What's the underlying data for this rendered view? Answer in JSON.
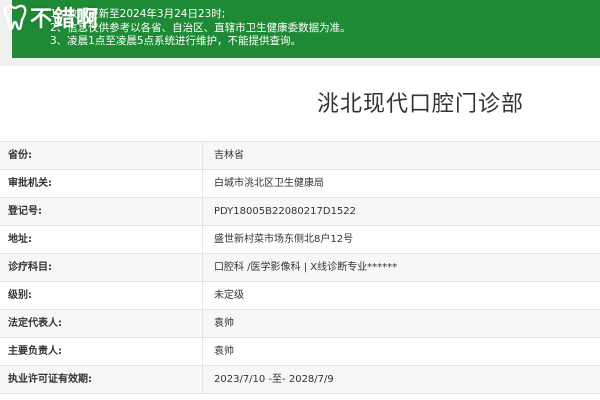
{
  "brand": {
    "name": "不錯啊"
  },
  "notice": {
    "lines": [
      "1、数据更新至2024年3月24日23时;",
      "2、信息仅供参考以各省、自治区、直辖市卫生健康委数据为准。",
      "3、凌晨1点至凌晨5点系统进行维护，不能提供查询。"
    ]
  },
  "page_title": "洮北现代口腔门诊部",
  "details": [
    {
      "label": "省份:",
      "value": "吉林省"
    },
    {
      "label": "审批机关:",
      "value": "白城市洮北区卫生健康局"
    },
    {
      "label": "登记号:",
      "value": "PDY18005B22080217D1522"
    },
    {
      "label": "地址:",
      "value": "盛世新村菜市场东侧北8户12号"
    },
    {
      "label": "诊疗科目:",
      "value": "口腔科 /医学影像科 | X线诊断专业******"
    },
    {
      "label": "级别:",
      "value": "未定级"
    },
    {
      "label": "法定代表人:",
      "value": "袁帅"
    },
    {
      "label": "主要负责人:",
      "value": "袁帅"
    },
    {
      "label": "执业许可证有效期:",
      "value": "2023/7/10 -至- 2028/7/9"
    }
  ],
  "colors": {
    "notice_bg": "#1e8a35",
    "strip_bg": "#f0f0f0"
  }
}
